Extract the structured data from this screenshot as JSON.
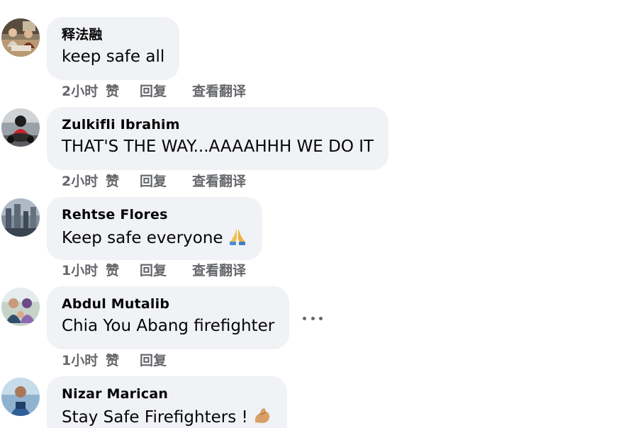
{
  "comments": [
    {
      "author": "释法融",
      "text": "keep safe all",
      "time": "2小时",
      "like": "赞",
      "reply": "回复",
      "translate": "查看翻译",
      "avatar": "monks-at-table-avatar"
    },
    {
      "author": "Zulkifli Ibrahim",
      "text": "THAT'S THE WAY...AAAAHHH WE DO IT",
      "time": "2小时",
      "like": "赞",
      "reply": "回复",
      "translate": "查看翻译",
      "avatar": "motorbike-rider-avatar"
    },
    {
      "author": "Rehtse Flores",
      "text": "Keep safe everyone",
      "emoji": "folded-hands-emoji",
      "time": "1小时",
      "like": "赞",
      "reply": "回复",
      "translate": "查看翻译",
      "avatar": "city-skyline-avatar"
    },
    {
      "author": "Abdul Mutalib",
      "text": "Chia You Abang firefighter",
      "time": "1小时",
      "like": "赞",
      "reply": "回复",
      "more_icon": "more-options-icon",
      "avatar": "family-photo-avatar"
    },
    {
      "author": "Nizar Marican",
      "text": "Stay Safe Firefighters !",
      "emoji": "flexed-biceps-emoji",
      "avatar": "man-outdoors-avatar"
    }
  ],
  "colors": {
    "bubble": "#f0f2f5",
    "text": "#050505",
    "meta": "#65676b"
  }
}
